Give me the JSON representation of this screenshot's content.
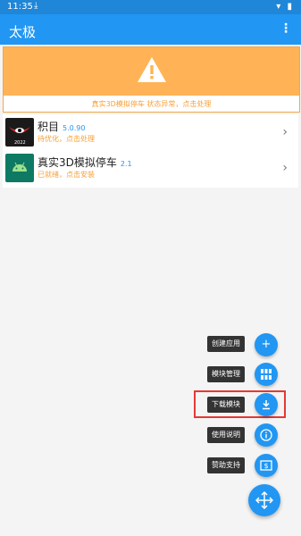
{
  "status_bar": {
    "time": "11:35"
  },
  "app_bar": {
    "title": "太极",
    "menu_icon": "overflow-menu-icon"
  },
  "warning": {
    "icon": "warning-triangle-icon",
    "message": "真实3D模拟停车 状态异常，点击处理",
    "banner_color": "#ffb356"
  },
  "modules": [
    {
      "name": "积目",
      "version": "5.0.90",
      "status": "待优化，点击处理",
      "thumb_label": "2022"
    },
    {
      "name": "真实3D模拟停车",
      "version": "2.1",
      "status": "已就绪，点击安装"
    }
  ],
  "fab_menu": [
    {
      "label": "创建应用",
      "icon": "plus-icon"
    },
    {
      "label": "模块管理",
      "icon": "grid-icon"
    },
    {
      "label": "下载模块",
      "icon": "download-icon"
    },
    {
      "label": "使用说明",
      "icon": "info-icon"
    },
    {
      "label": "赞助支持",
      "icon": "dollar-icon"
    }
  ],
  "fab_main_icon": "move-arrows-icon",
  "colors": {
    "accent": "#2196f3",
    "warning": "#f7a035",
    "highlight": "#e53935"
  }
}
